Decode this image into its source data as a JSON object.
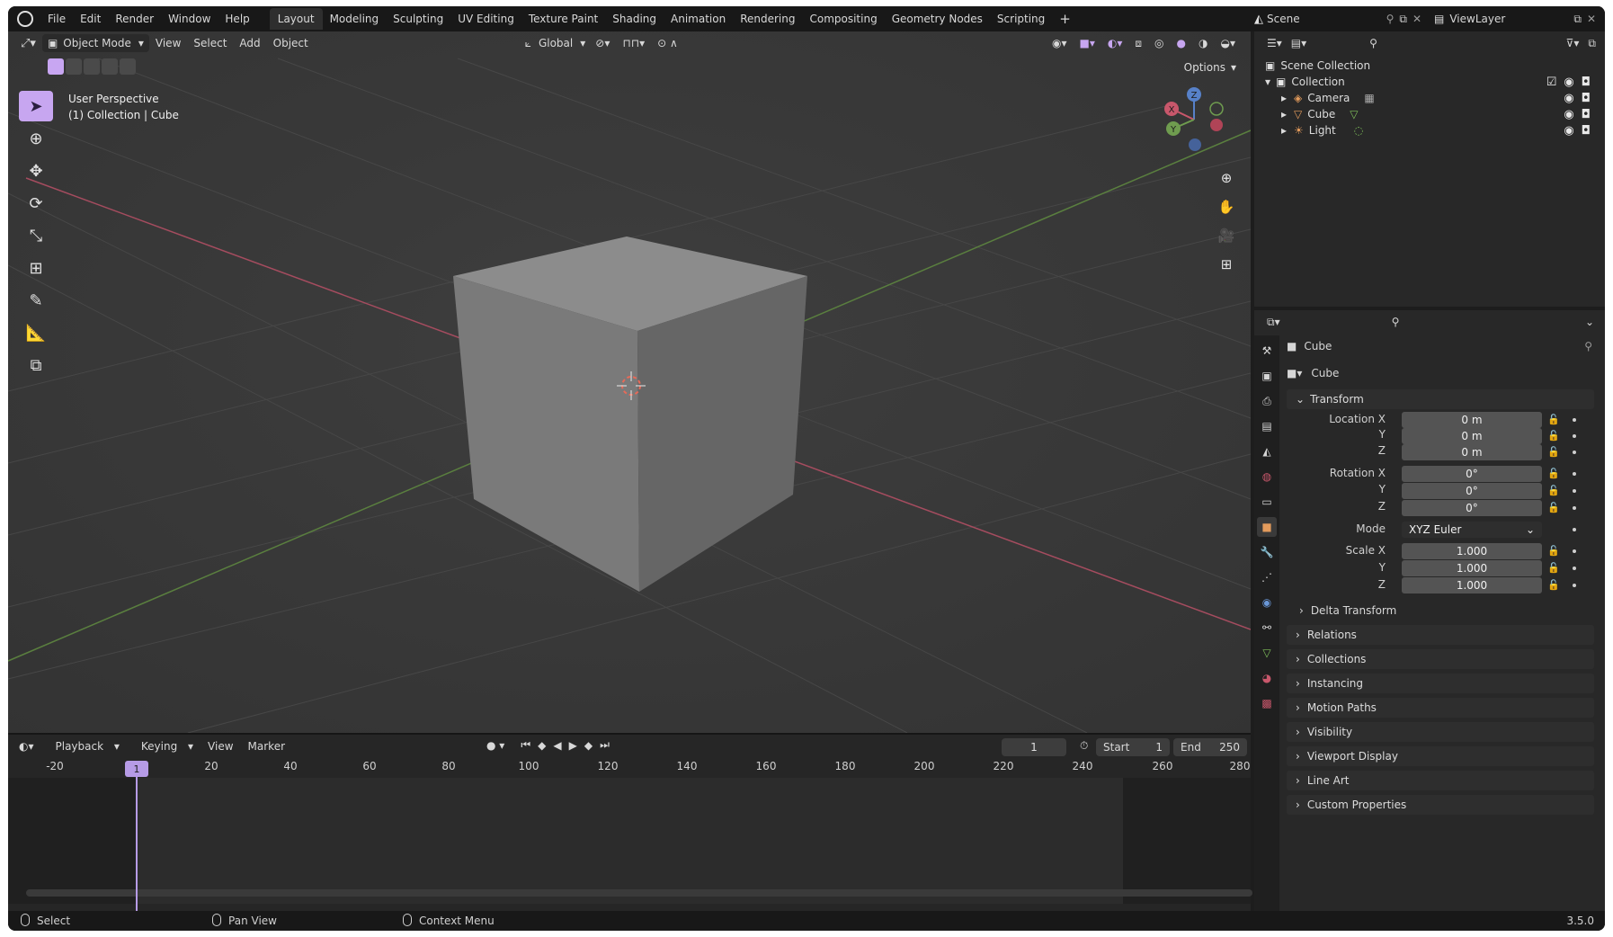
{
  "topbar": {
    "menus": [
      "File",
      "Edit",
      "Render",
      "Window",
      "Help"
    ],
    "workspaces": [
      "Layout",
      "Modeling",
      "Sculpting",
      "UV Editing",
      "Texture Paint",
      "Shading",
      "Animation",
      "Rendering",
      "Compositing",
      "Geometry Nodes",
      "Scripting"
    ],
    "active_workspace": "Layout",
    "add_tab": "+",
    "scene": "Scene",
    "view_layer": "ViewLayer"
  },
  "viewport": {
    "mode": "Object Mode",
    "menus": [
      "View",
      "Select",
      "Add",
      "Object"
    ],
    "transform_orientation": "Global",
    "options": "Options",
    "info_line1": "User Perspective",
    "info_line2": "(1) Collection | Cube",
    "gizmo": {
      "x": "X",
      "y": "Y",
      "z": "Z"
    }
  },
  "timeline": {
    "menus": [
      "Playback",
      "Keying",
      "View",
      "Marker"
    ],
    "current_frame": "1",
    "start_label": "Start",
    "start_value": "1",
    "end_label": "End",
    "end_value": "250",
    "ruler": [
      "-20",
      "20",
      "40",
      "60",
      "80",
      "100",
      "120",
      "140",
      "160",
      "180",
      "200",
      "220",
      "240",
      "260",
      "280"
    ],
    "playhead": "1"
  },
  "statusbar": {
    "select": "Select",
    "pan": "Pan View",
    "context": "Context Menu",
    "version": "3.5.0"
  },
  "outliner": {
    "scene_collection": "Scene Collection",
    "collection": "Collection",
    "items": [
      "Camera",
      "Cube",
      "Light"
    ]
  },
  "properties": {
    "object_name": "Cube",
    "datablock_name": "Cube",
    "transform_header": "Transform",
    "location_label": "Location X",
    "rotation_label": "Rotation X",
    "mode_label": "Mode",
    "scale_label": "Scale X",
    "y_label": "Y",
    "z_label": "Z",
    "location": [
      "0 m",
      "0 m",
      "0 m"
    ],
    "rotation": [
      "0°",
      "0°",
      "0°"
    ],
    "rotation_mode": "XYZ Euler",
    "scale": [
      "1.000",
      "1.000",
      "1.000"
    ],
    "delta_transform": "Delta Transform",
    "panels": [
      "Relations",
      "Collections",
      "Instancing",
      "Motion Paths",
      "Visibility",
      "Viewport Display",
      "Line Art",
      "Custom Properties"
    ]
  },
  "colors": {
    "accent": "#c7a6f0",
    "x_axis": "#c8576b",
    "y_axis": "#6f9c4f",
    "z_axis": "#5781c9"
  }
}
